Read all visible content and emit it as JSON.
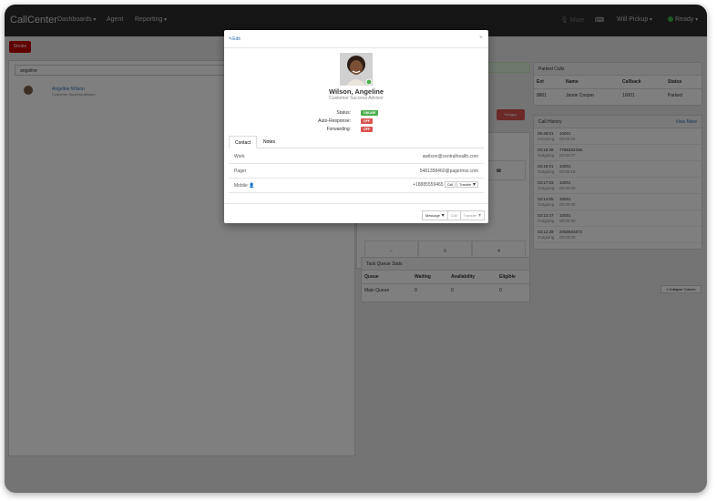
{
  "navbar": {
    "brand": "CallCenter",
    "items": [
      "Dashboards",
      "Agent",
      "Reporting"
    ],
    "mute": "Mute",
    "user": "Will Pickup",
    "status": "Ready"
  },
  "toolbar": {
    "red_button": "Stroke"
  },
  "search": {
    "value": "angeline"
  },
  "results": [
    {
      "name": "Angeline Wilson",
      "title": "Customer Success Advisor"
    }
  ],
  "hangup_label": "Hangup",
  "parked_calls": {
    "title": "Parked Calls",
    "columns": [
      "Ext",
      "Name",
      "Callback",
      "Status"
    ],
    "rows": [
      [
        "8801",
        "Jamie Cooper",
        "10001",
        "Parked"
      ]
    ]
  },
  "call_history": {
    "title": "Call History",
    "view_more": "View More",
    "items": [
      {
        "time": "05:48:01",
        "number": "10001",
        "dir": "Incoming",
        "dur": "00:00:53"
      },
      {
        "time": "03:18:39",
        "number": "7785334336",
        "dir": "Outgoing",
        "dur": "00:00:07"
      },
      {
        "time": "03:19:01",
        "number": "10001",
        "dir": "Outgoing",
        "dur": "00:00:16"
      },
      {
        "time": "03:17:03",
        "number": "10001",
        "dir": "Outgoing",
        "dur": "00:00:00"
      },
      {
        "time": "03:14:05",
        "number": "10001",
        "dir": "Outgoing",
        "dur": "00:00:00"
      },
      {
        "time": "03:13:47",
        "number": "10001",
        "dir": "Outgoing",
        "dur": "00:00:00"
      },
      {
        "time": "03:12:29",
        "number": "2068604873",
        "dir": "Outgoing",
        "dur": "00:00:00"
      }
    ]
  },
  "collapse_label": "« Collapse Column",
  "task_queue": {
    "title": "Task Queue Stats",
    "columns": [
      "Queue",
      "Waiting",
      "Availability",
      "Eligible"
    ],
    "rows": [
      [
        "Main Queue",
        "0",
        "0",
        "0"
      ]
    ]
  },
  "mid_grid": {
    "v1": "0",
    "v2": "4",
    "v3": "–"
  },
  "modal": {
    "edit": "Edit",
    "close": "×",
    "name": "Wilson, Angeline",
    "title": "Customer Success Advisor",
    "status_label": "Status:",
    "status_value": "ONLINE",
    "autoresp_label": "Auto-Response:",
    "autoresp_value": "OFF",
    "forward_label": "Forwarding:",
    "forward_value": "OFF",
    "tabs": [
      "Contact",
      "Notes"
    ],
    "contacts": [
      {
        "label": "Work",
        "value": "awilson@centralhealth.com"
      },
      {
        "label": "Pager",
        "value": "5481358460@pagermsi.com"
      },
      {
        "label": "Mobile",
        "value": "+18885559465",
        "call": "Call",
        "transfer": "Transfer"
      }
    ],
    "footer": {
      "message": "Message",
      "call": "Call",
      "transfer": "Transfer"
    }
  },
  "colors": {
    "online": "#4cae4c",
    "off": "#d9534f",
    "brand_red": "#c40000"
  }
}
